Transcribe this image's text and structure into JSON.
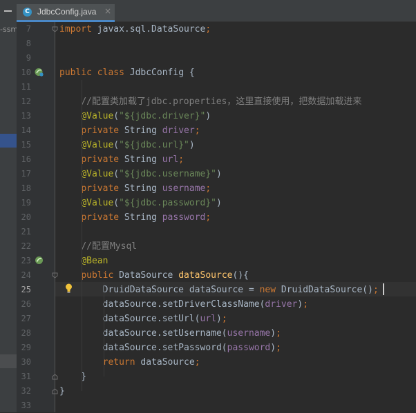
{
  "tab": {
    "file_name": "JdbcConfig.java",
    "icon_letter": "C",
    "close_glyph": "×"
  },
  "project_panel": {
    "fragment": "-ssm"
  },
  "colors": {
    "keyword": "#cc7832",
    "annotation": "#bbb529",
    "string": "#6a8759",
    "field": "#9876aa",
    "method_decl": "#ffc66d",
    "comment": "#808080",
    "default": "#a9b7c6",
    "tab_underline": "#4a88c7"
  },
  "editor": {
    "active_line": 25,
    "lines": [
      {
        "n": 7,
        "tokens": [
          [
            "kw",
            "import"
          ],
          [
            "plain",
            " javax.sql.DataSource"
          ],
          [
            "kw",
            ";"
          ]
        ]
      },
      {
        "n": 8,
        "tokens": []
      },
      {
        "n": 9,
        "tokens": []
      },
      {
        "n": 10,
        "tokens": [
          [
            "kw",
            "public class"
          ],
          [
            "plain",
            " JdbcConfig {"
          ]
        ]
      },
      {
        "n": 11,
        "tokens": []
      },
      {
        "n": 12,
        "tokens": [
          [
            "plain",
            "    "
          ],
          [
            "cmt",
            "//配置类加载了jdbc.properties，这里直接使用，把数据加载进来"
          ]
        ]
      },
      {
        "n": 13,
        "tokens": [
          [
            "plain",
            "    "
          ],
          [
            "ann",
            "@Value"
          ],
          [
            "plain",
            "("
          ],
          [
            "str",
            "\"${jdbc.driver}\""
          ],
          [
            "plain",
            ")"
          ]
        ]
      },
      {
        "n": 14,
        "tokens": [
          [
            "plain",
            "    "
          ],
          [
            "kw",
            "private"
          ],
          [
            "plain",
            " String "
          ],
          [
            "fld",
            "driver"
          ],
          [
            "kw",
            ";"
          ]
        ]
      },
      {
        "n": 15,
        "tokens": [
          [
            "plain",
            "    "
          ],
          [
            "ann",
            "@Value"
          ],
          [
            "plain",
            "("
          ],
          [
            "str",
            "\"${jdbc.url}\""
          ],
          [
            "plain",
            ")"
          ]
        ]
      },
      {
        "n": 16,
        "tokens": [
          [
            "plain",
            "    "
          ],
          [
            "kw",
            "private"
          ],
          [
            "plain",
            " String "
          ],
          [
            "fld",
            "url"
          ],
          [
            "kw",
            ";"
          ]
        ]
      },
      {
        "n": 17,
        "tokens": [
          [
            "plain",
            "    "
          ],
          [
            "ann",
            "@Value"
          ],
          [
            "plain",
            "("
          ],
          [
            "str",
            "\"${jdbc.username}\""
          ],
          [
            "plain",
            ")"
          ]
        ]
      },
      {
        "n": 18,
        "tokens": [
          [
            "plain",
            "    "
          ],
          [
            "kw",
            "private"
          ],
          [
            "plain",
            " String "
          ],
          [
            "fld",
            "username"
          ],
          [
            "kw",
            ";"
          ]
        ]
      },
      {
        "n": 19,
        "tokens": [
          [
            "plain",
            "    "
          ],
          [
            "ann",
            "@Value"
          ],
          [
            "plain",
            "("
          ],
          [
            "str",
            "\"${jdbc.password}\""
          ],
          [
            "plain",
            ")"
          ]
        ]
      },
      {
        "n": 20,
        "tokens": [
          [
            "plain",
            "    "
          ],
          [
            "kw",
            "private"
          ],
          [
            "plain",
            " String "
          ],
          [
            "fld",
            "password"
          ],
          [
            "kw",
            ";"
          ]
        ]
      },
      {
        "n": 21,
        "tokens": []
      },
      {
        "n": 22,
        "tokens": [
          [
            "plain",
            "    "
          ],
          [
            "cmt",
            "//配置Mysql"
          ]
        ]
      },
      {
        "n": 23,
        "tokens": [
          [
            "plain",
            "    "
          ],
          [
            "ann",
            "@Bean"
          ]
        ]
      },
      {
        "n": 24,
        "tokens": [
          [
            "plain",
            "    "
          ],
          [
            "kw",
            "public"
          ],
          [
            "plain",
            " DataSource "
          ],
          [
            "fn",
            "dataSource"
          ],
          [
            "plain",
            "(){"
          ]
        ]
      },
      {
        "n": 25,
        "tokens": [
          [
            "plain",
            "        DruidDataSource dataSource = "
          ],
          [
            "kw",
            "new"
          ],
          [
            "plain",
            " DruidDataSource()"
          ],
          [
            "kw",
            ";"
          ]
        ]
      },
      {
        "n": 26,
        "tokens": [
          [
            "plain",
            "        dataSource.setDriverClassName("
          ],
          [
            "fld",
            "driver"
          ],
          [
            "plain",
            ")"
          ],
          [
            "kw",
            ";"
          ]
        ]
      },
      {
        "n": 27,
        "tokens": [
          [
            "plain",
            "        dataSource.setUrl("
          ],
          [
            "fld",
            "url"
          ],
          [
            "plain",
            ")"
          ],
          [
            "kw",
            ";"
          ]
        ]
      },
      {
        "n": 28,
        "tokens": [
          [
            "plain",
            "        dataSource.setUsername("
          ],
          [
            "fld",
            "username"
          ],
          [
            "plain",
            ")"
          ],
          [
            "kw",
            ";"
          ]
        ]
      },
      {
        "n": 29,
        "tokens": [
          [
            "plain",
            "        dataSource.setPassword("
          ],
          [
            "fld",
            "password"
          ],
          [
            "plain",
            ")"
          ],
          [
            "kw",
            ";"
          ]
        ]
      },
      {
        "n": 30,
        "tokens": [
          [
            "plain",
            "        "
          ],
          [
            "kw",
            "return"
          ],
          [
            "plain",
            " dataSource"
          ],
          [
            "kw",
            ";"
          ]
        ]
      },
      {
        "n": 31,
        "tokens": [
          [
            "plain",
            "    }"
          ]
        ]
      },
      {
        "n": 32,
        "tokens": [
          [
            "plain",
            "}"
          ]
        ]
      },
      {
        "n": 33,
        "tokens": []
      }
    ]
  },
  "gutter_icons": [
    {
      "line": 10,
      "name": "spring-bean-class-icon"
    },
    {
      "line": 23,
      "name": "spring-bean-method-icon"
    }
  ]
}
